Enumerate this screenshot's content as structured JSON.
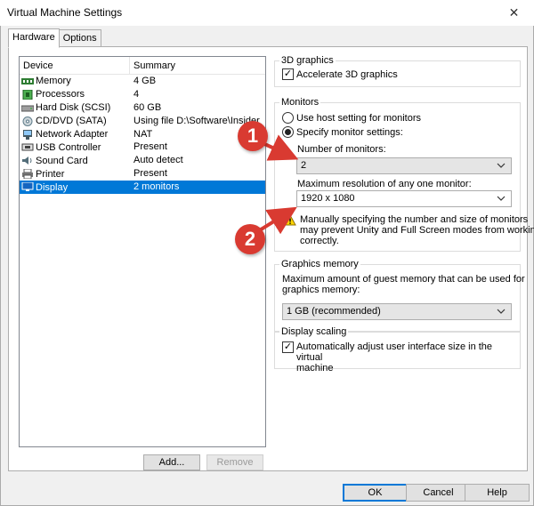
{
  "window": {
    "title": "Virtual Machine Settings"
  },
  "tabs": [
    {
      "label": "Hardware"
    },
    {
      "label": "Options"
    }
  ],
  "device_list": {
    "headers": {
      "device": "Device",
      "summary": "Summary"
    },
    "rows": [
      {
        "device": "Memory",
        "summary": "4 GB",
        "icon": "memory-icon"
      },
      {
        "device": "Processors",
        "summary": "4",
        "icon": "processor-icon"
      },
      {
        "device": "Hard Disk (SCSI)",
        "summary": "60 GB",
        "icon": "hard-disk-icon"
      },
      {
        "device": "CD/DVD (SATA)",
        "summary": "Using file D:\\Software\\Insider",
        "icon": "cd-dvd-icon"
      },
      {
        "device": "Network Adapter",
        "summary": "NAT",
        "icon": "network-adapter-icon"
      },
      {
        "device": "USB Controller",
        "summary": "Present",
        "icon": "usb-controller-icon"
      },
      {
        "device": "Sound Card",
        "summary": "Auto detect",
        "icon": "sound-card-icon"
      },
      {
        "device": "Printer",
        "summary": "Present",
        "icon": "printer-icon"
      },
      {
        "device": "Display",
        "summary": "2 monitors",
        "icon": "display-icon",
        "selected": true
      }
    ],
    "add_label": "Add...",
    "remove_label": "Remove"
  },
  "graphics3d": {
    "title": "3D graphics",
    "accelerate_label": "Accelerate 3D graphics",
    "accelerate_checked": true
  },
  "monitors": {
    "title": "Monitors",
    "host_setting_label": "Use host setting for monitors",
    "specify_label": "Specify monitor settings:",
    "specify_selected": true,
    "number_label": "Number of monitors:",
    "number_value": "2",
    "max_res_label": "Maximum resolution of any one monitor:",
    "max_res_value": "1920 x 1080",
    "warning_line1": "Manually specifying the number and size of monitors",
    "warning_line2": "may prevent Unity and Full Screen modes from working",
    "warning_line3": "correctly."
  },
  "graphics_memory": {
    "title": "Graphics memory",
    "desc_line1": "Maximum amount of guest memory that can be used for",
    "desc_line2": "graphics memory:",
    "value": "1 GB (recommended)"
  },
  "display_scaling": {
    "title": "Display scaling",
    "auto_adjust_line1": "Automatically adjust user interface size in the virtual",
    "auto_adjust_line2": "machine",
    "auto_adjust_checked": true
  },
  "footer": {
    "ok_label": "OK",
    "cancel_label": "Cancel",
    "help_label": "Help"
  },
  "annotations": {
    "marker1": "1",
    "marker2": "2"
  },
  "colors": {
    "selection": "#0078d7",
    "marker": "#d93a31"
  }
}
